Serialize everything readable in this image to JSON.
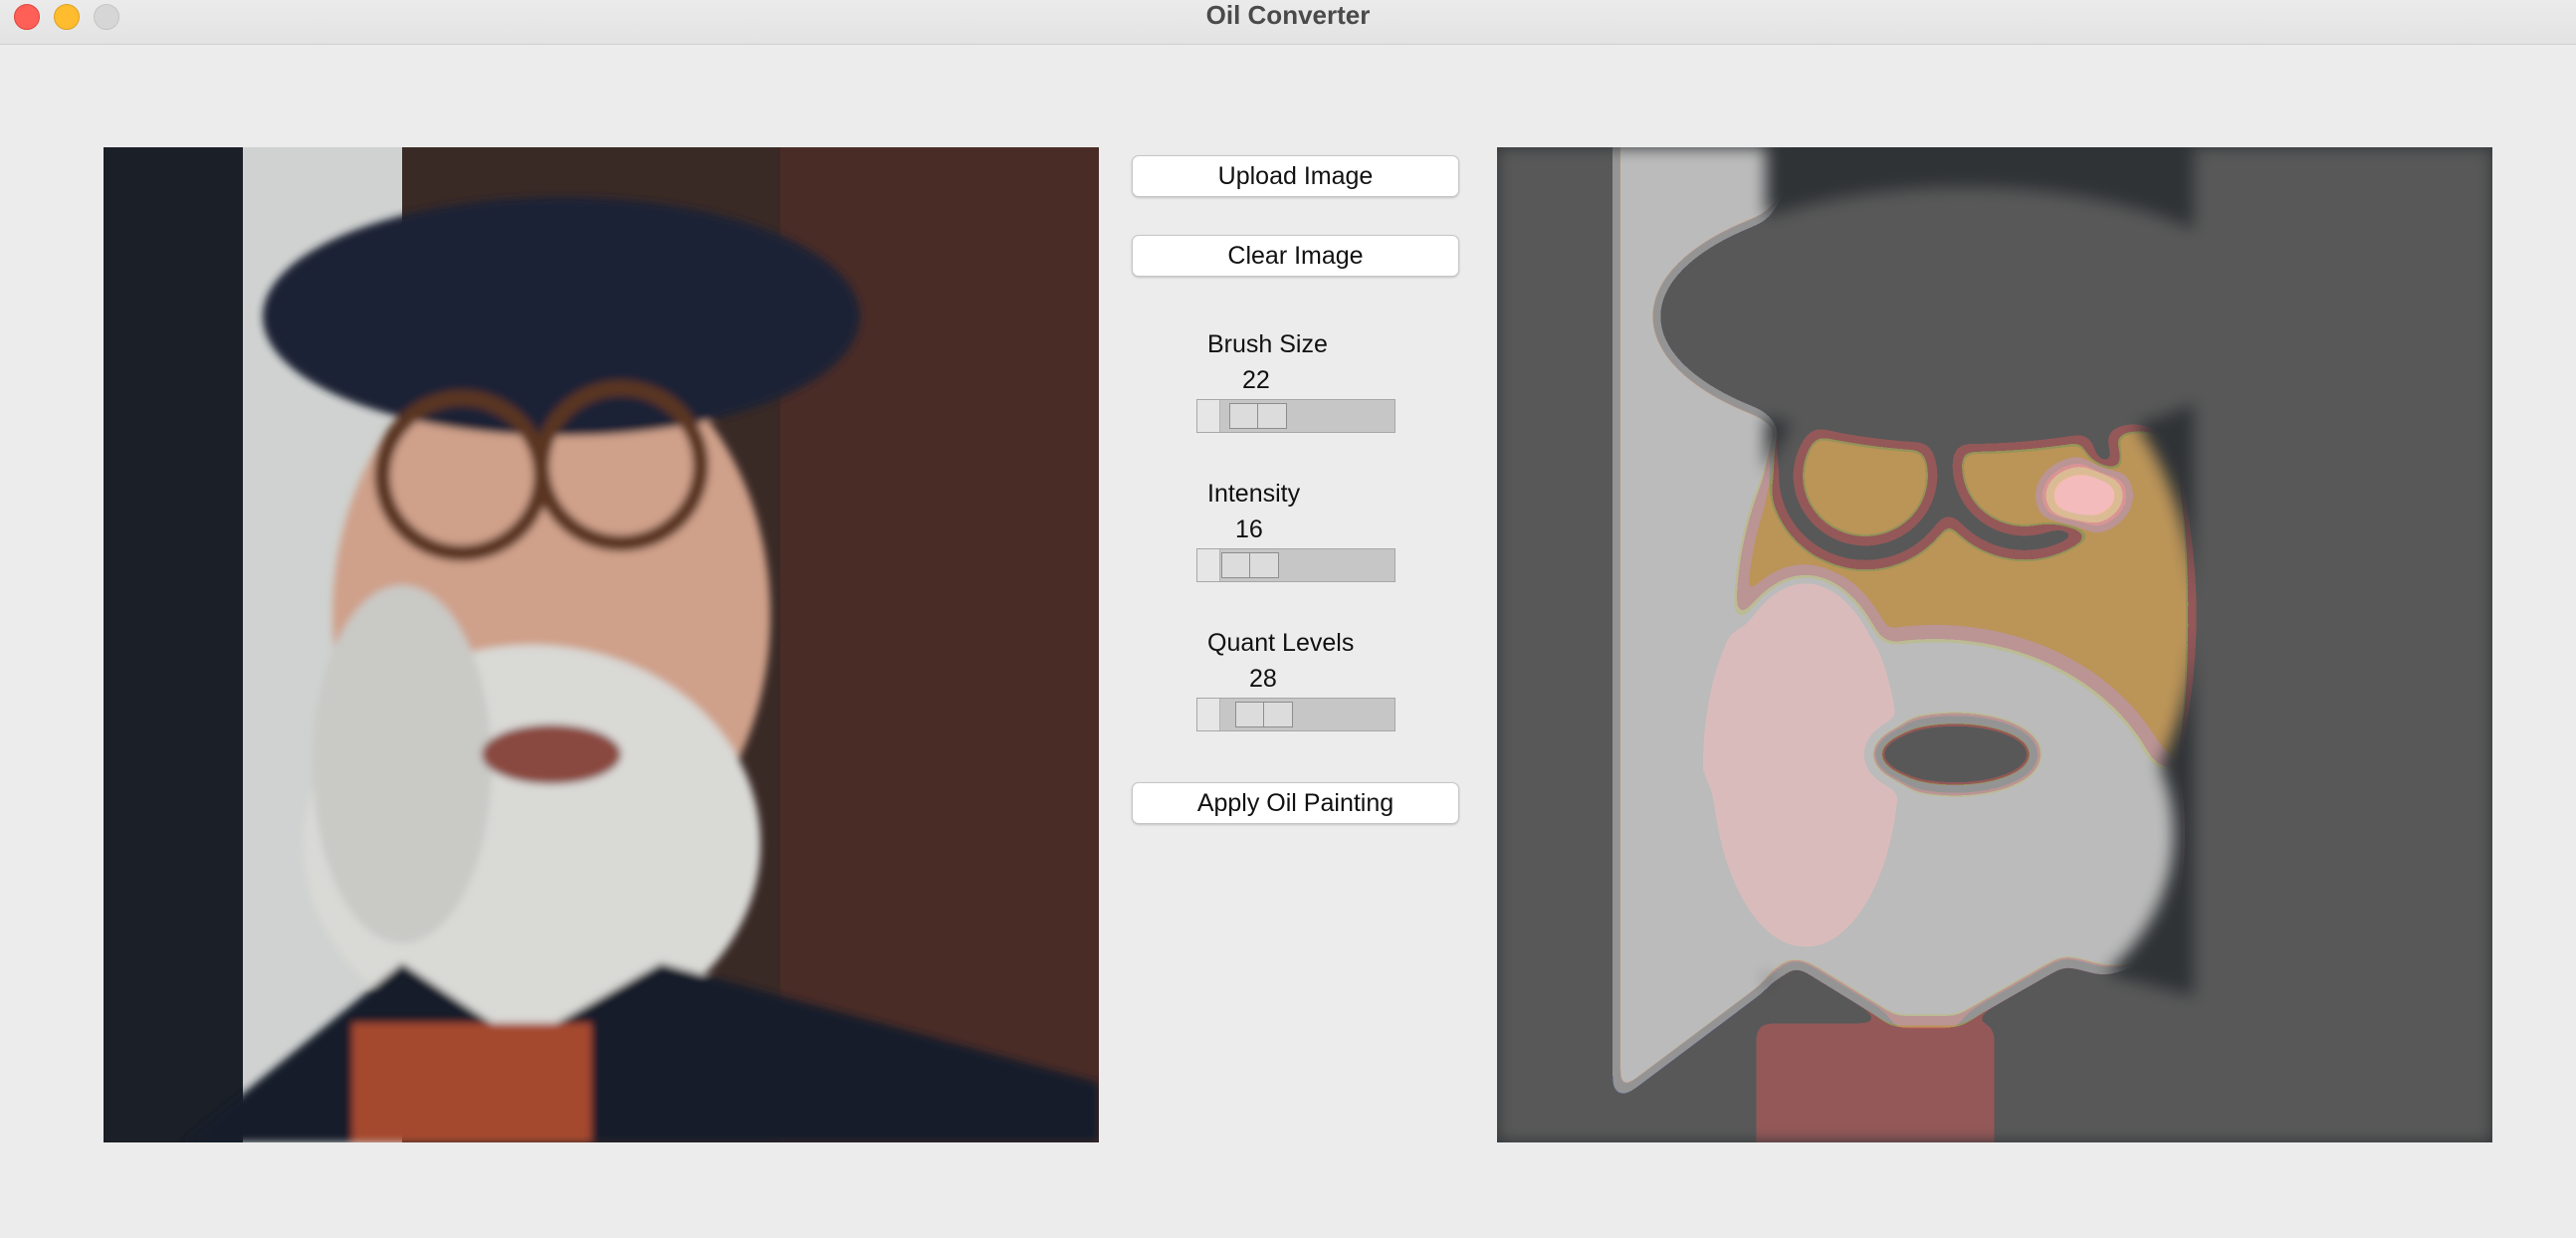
{
  "window": {
    "title": "Oil Converter"
  },
  "buttons": {
    "upload": "Upload Image",
    "clear": "Clear Image",
    "apply": "Apply Oil Painting"
  },
  "sliders": {
    "brush_size": {
      "label": "Brush Size",
      "value": "22"
    },
    "intensity": {
      "label": "Intensity",
      "value": "16"
    },
    "quant_levels": {
      "label": "Quant Levels",
      "value": "28"
    }
  },
  "images": {
    "original": "photo-portrait-original",
    "converted": "photo-portrait-oil-painting"
  },
  "colors": {
    "background": "#ececec",
    "close": "#fe5f57",
    "minimize": "#febc2e",
    "zoom": "#d6d6d6"
  }
}
